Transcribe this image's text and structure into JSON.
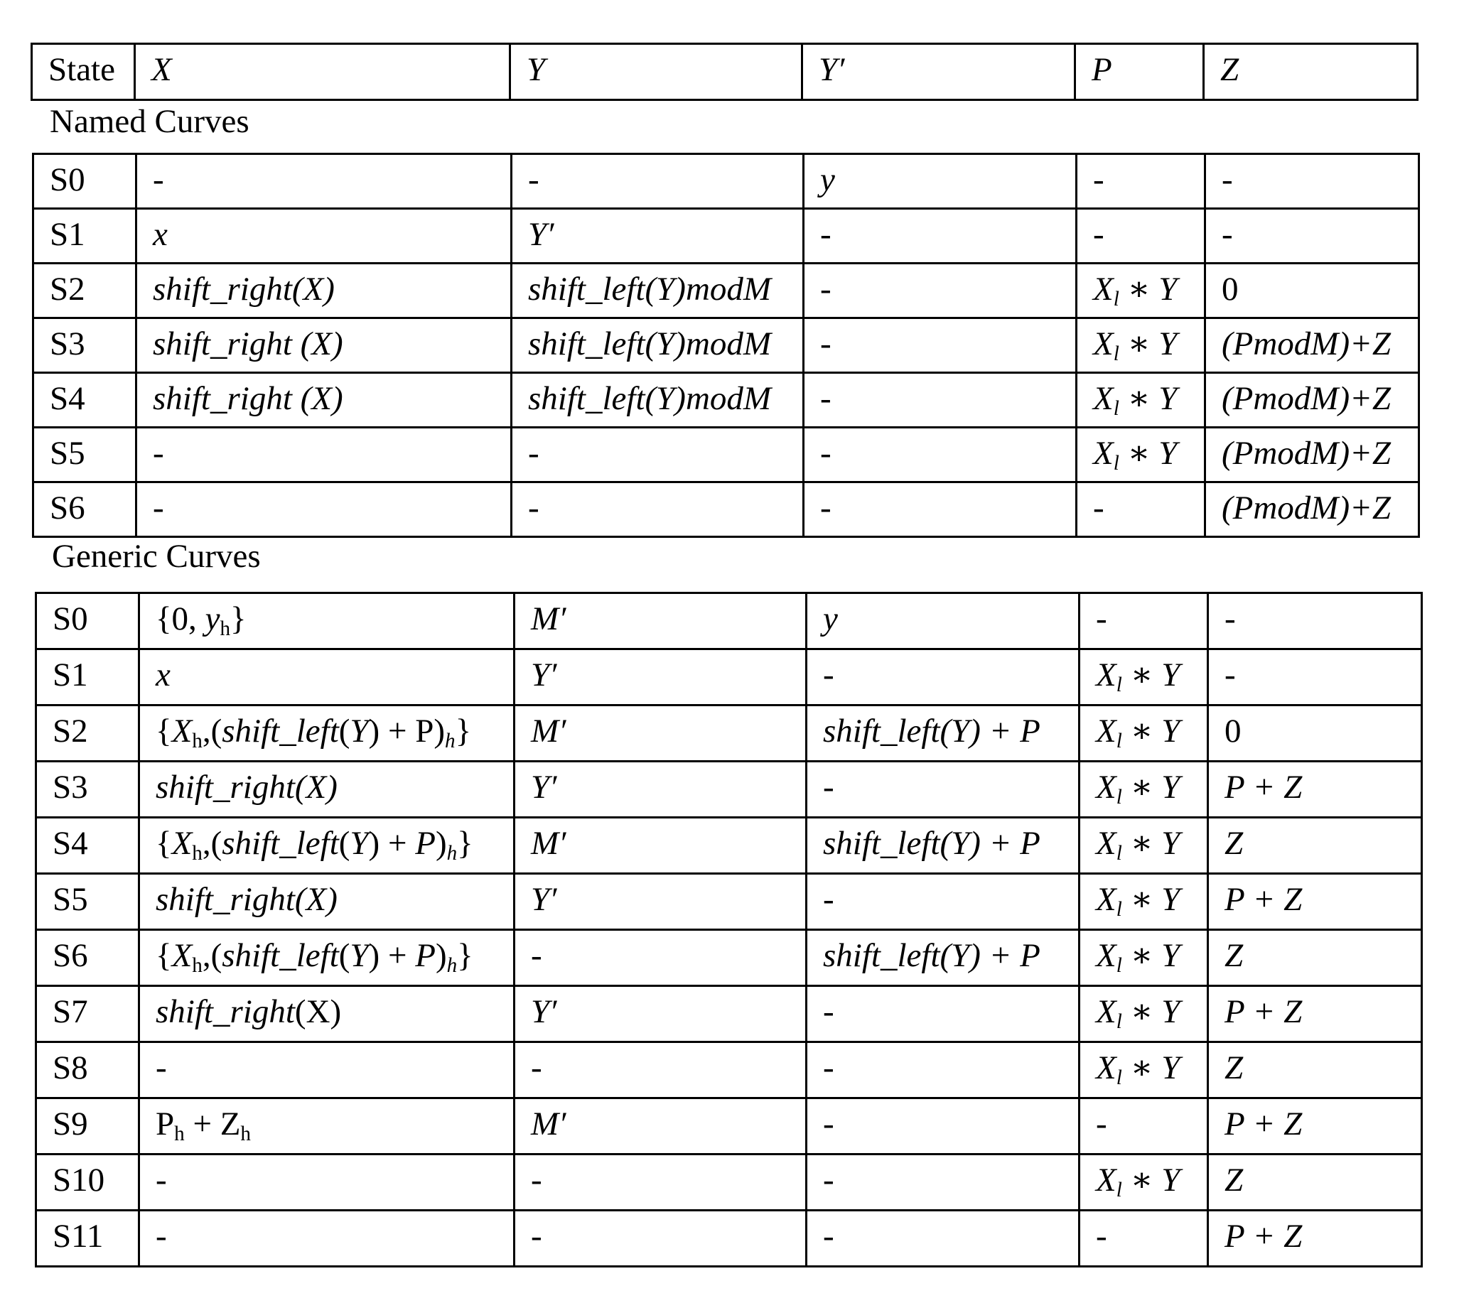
{
  "header": {
    "columns": [
      "State",
      "X",
      "Y",
      "Y′",
      "P",
      "Z"
    ]
  },
  "sections": {
    "named": {
      "label": "Named Curves",
      "rows": [
        {
          "state": "S0",
          "x": "-",
          "y": "-",
          "yp": "y",
          "p": "-",
          "z": "-"
        },
        {
          "state": "S1",
          "x": "x",
          "y": "Y′",
          "yp": "-",
          "p": "-",
          "z": "-"
        },
        {
          "state": "S2",
          "x": "shift_right(X)",
          "y": "shift_left(Y)modM",
          "yp": "-",
          "p": "X_l ∗ Y",
          "z": "0"
        },
        {
          "state": "S3",
          "x": "shift_right (X)",
          "y": "shift_left(Y)modM",
          "yp": "-",
          "p": "X_l ∗ Y",
          "z": "(PmodM)+Z"
        },
        {
          "state": "S4",
          "x": "shift_right (X)",
          "y": "shift_left(Y)modM",
          "yp": "-",
          "p": "X_l ∗ Y",
          "z": "(PmodM)+Z"
        },
        {
          "state": "S5",
          "x": "-",
          "y": "-",
          "yp": "-",
          "p": "X_l ∗ Y",
          "z": "(PmodM)+Z"
        },
        {
          "state": "S6",
          "x": "-",
          "y": "-",
          "yp": "-",
          "p": "-",
          "z": "(PmodM)+Z"
        }
      ]
    },
    "generic": {
      "label": "Generic Curves",
      "rows": [
        {
          "state": "S0",
          "x": "{0, y_h}",
          "y": "M′",
          "yp": "y",
          "p": "-",
          "z": "-"
        },
        {
          "state": "S1",
          "x": "x",
          "y": "Y′",
          "yp": "-",
          "p": "X_l ∗ Y",
          "z": "-"
        },
        {
          "state": "S2",
          "x": "{X_h,(shift_left(Y) + P)_h}",
          "y": "M′",
          "yp": "shift_left(Y) + P",
          "p": "X_l ∗ Y",
          "z": "0"
        },
        {
          "state": "S3",
          "x": "shift_right(X)",
          "y": "Y′",
          "yp": "-",
          "p": "X_l ∗ Y",
          "z": "P + Z"
        },
        {
          "state": "S4",
          "x": "{X_h,(shift_left(Y) + P)_h}",
          "y": "M′",
          "yp": "shift_left(Y) + P",
          "p": "X_l ∗ Y",
          "z": "Z"
        },
        {
          "state": "S5",
          "x": "shift_right(X)",
          "y": "Y′",
          "yp": "-",
          "p": "X_l ∗ Y",
          "z": "P + Z"
        },
        {
          "state": "S6",
          "x": "{X_h,(shift_left(Y) + P)_h}",
          "y": "-",
          "yp": "shift_left(Y) + P",
          "p": "X_l ∗ Y",
          "z": "Z"
        },
        {
          "state": "S7",
          "x": "shift_right(X)",
          "y": "Y′",
          "yp": "-",
          "p": "X_l ∗ Y",
          "z": "P + Z"
        },
        {
          "state": "S8",
          "x": "-",
          "y": "-",
          "yp": "-",
          "p": "X_l ∗ Y",
          "z": "Z"
        },
        {
          "state": "S9",
          "x": "P_h + Z_h",
          "y": "M′",
          "yp": "-",
          "p": "-",
          "z": "P + Z"
        },
        {
          "state": "S10",
          "x": "-",
          "y": "-",
          "yp": "-",
          "p": "X_l ∗ Y",
          "z": "Z"
        },
        {
          "state": "S11",
          "x": "-",
          "y": "-",
          "yp": "-",
          "p": "-",
          "z": "P + Z"
        }
      ]
    }
  }
}
